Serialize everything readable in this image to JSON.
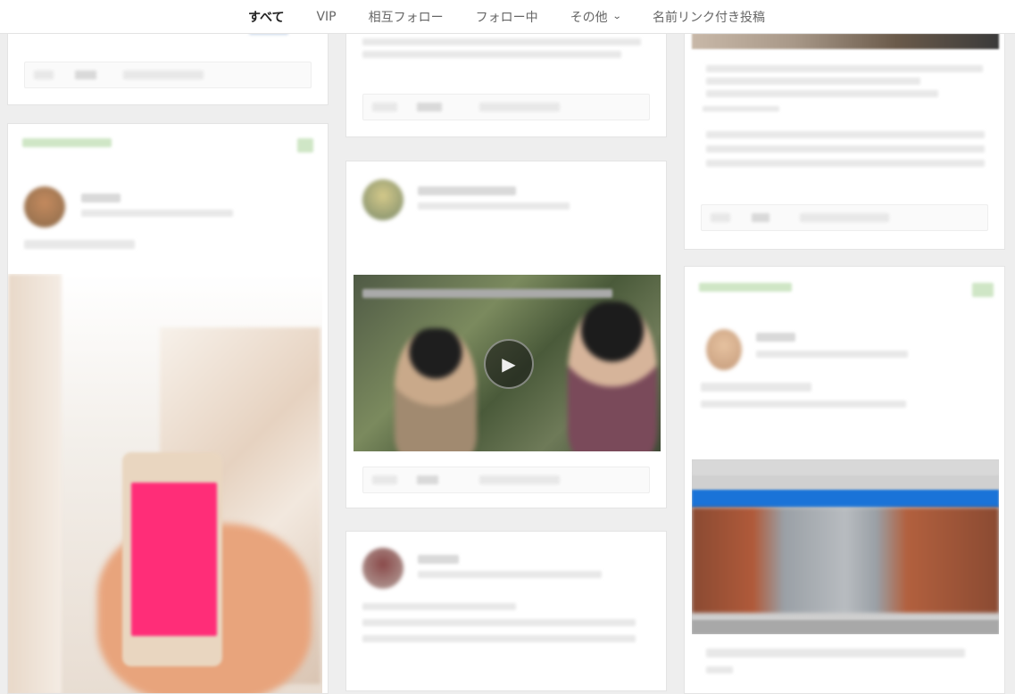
{
  "nav": {
    "tabs": [
      {
        "label": "すべて",
        "active": true
      },
      {
        "label": "VIP",
        "active": false
      },
      {
        "label": "相互フォロー",
        "active": false
      },
      {
        "label": "フォロー中",
        "active": false
      },
      {
        "label": "その他",
        "active": false
      },
      {
        "label": "名前リンク付き投稿",
        "active": false
      }
    ]
  },
  "colors": {
    "accent_green": "#cfe6c6",
    "pink_screen": "#ff2d78",
    "blue_bar": "#1a73d8"
  }
}
